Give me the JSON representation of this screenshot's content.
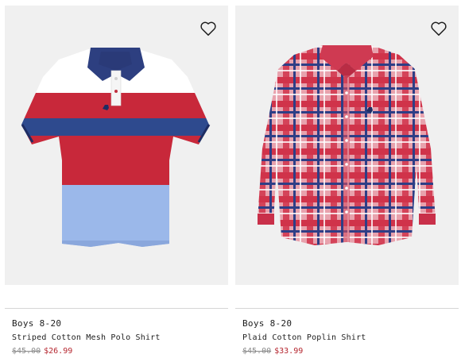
{
  "products": [
    {
      "category": "Boys 8-20",
      "name": "Striped Cotton Mesh Polo Shirt",
      "original_price": "$45.00",
      "sale_price": "$26.99",
      "image": "striped-polo-shirt",
      "wishlist_icon": "heart-outline-icon"
    },
    {
      "category": "Boys 8-20",
      "name": "Plaid Cotton Poplin Shirt",
      "original_price": "$45.00",
      "sale_price": "$33.99",
      "image": "plaid-button-down-shirt",
      "wishlist_icon": "heart-outline-icon"
    }
  ],
  "colors": {
    "sale_price": "#b5262f",
    "original_price": "#8a8a8a",
    "image_background": "#f0f0f0"
  }
}
